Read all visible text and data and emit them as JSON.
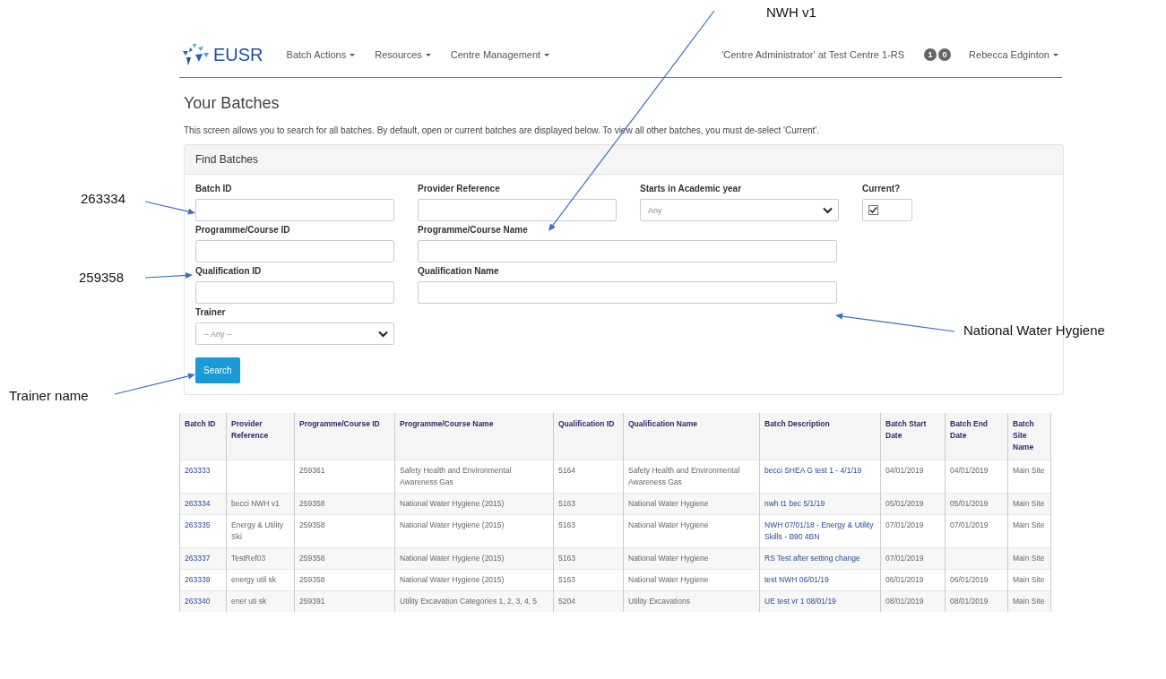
{
  "nav": {
    "brand": "EUSR",
    "menus": [
      {
        "label": "Batch Actions"
      },
      {
        "label": "Resources"
      },
      {
        "label": "Centre Management"
      }
    ],
    "role": "'Centre Administrator' at Test Centre 1-RS",
    "badges": [
      "1",
      "0"
    ],
    "user": "Rebecca Edginton"
  },
  "page": {
    "title": "Your Batches",
    "description": "This screen allows you to search for all batches. By default, open or current batches are displayed below. To view all other batches, you must de-select 'Current'."
  },
  "search_panel": {
    "title": "Find Batches",
    "rows": [
      [
        {
          "label": "Batch ID",
          "kind": "text"
        },
        {
          "label": "Provider Reference",
          "kind": "text"
        },
        {
          "label": "Starts in Academic year",
          "kind": "select",
          "value": "Any"
        },
        {
          "label": "Current?",
          "kind": "checkbox",
          "checked": true
        }
      ],
      [
        {
          "label": "Programme/Course ID",
          "kind": "text"
        },
        {
          "label": "Programme/Course Name",
          "kind": "wide-text"
        }
      ],
      [
        {
          "label": "Qualification ID",
          "kind": "text"
        },
        {
          "label": "Qualification Name",
          "kind": "wide-text"
        }
      ],
      [
        {
          "label": "Trainer",
          "kind": "select",
          "value": "-- Any --"
        }
      ]
    ],
    "button": "Search"
  },
  "table": {
    "columns": [
      {
        "label": "Batch ID",
        "kind": "link"
      },
      {
        "label": "Provider Reference",
        "kind": "text"
      },
      {
        "label": "Programme/Course ID",
        "kind": "text"
      },
      {
        "label": "Programme/Course Name",
        "kind": "text"
      },
      {
        "label": "Qualification ID",
        "kind": "text"
      },
      {
        "label": "Qualification Name",
        "kind": "text"
      },
      {
        "label": "Batch Description",
        "kind": "link"
      },
      {
        "label": "Batch Start Date",
        "kind": "text"
      },
      {
        "label": "Batch End Date",
        "kind": "text"
      },
      {
        "label": "Batch Site Name",
        "kind": "text"
      }
    ],
    "rows": [
      [
        "263333",
        "",
        "259361",
        "Safety Health and Environmental Awareness Gas",
        "5164",
        "Safety Health and Environmental Awareness Gas",
        "becci SHEA G test 1 - 4/1/19",
        "04/01/2019",
        "04/01/2019",
        "Main Site"
      ],
      [
        "263334",
        "becci NWH v1",
        "259358",
        "National Water Hygiene (2015)",
        "5163",
        "National Water Hygiene",
        "nwh t1 bec 5/1/19",
        "05/01/2019",
        "05/01/2019",
        "Main Site"
      ],
      [
        "263335",
        "Energy & Utility Ski",
        "259358",
        "National Water Hygiene (2015)",
        "5163",
        "National Water Hygiene",
        "NWH 07/01/18 - Energy & Utility Skills - B90 4BN",
        "07/01/2019",
        "07/01/2019",
        "Main Site"
      ],
      [
        "263337",
        "TestRef03",
        "259358",
        "National Water Hygiene (2015)",
        "5163",
        "National Water Hygiene",
        "RS Test after setting change",
        "07/01/2019",
        "",
        "Main Site"
      ],
      [
        "263339",
        "energy util sk",
        "259358",
        "National Water Hygiene (2015)",
        "5163",
        "National Water Hygiene",
        "test NWH 06/01/19",
        "06/01/2019",
        "06/01/2019",
        "Main Site"
      ],
      [
        "263340",
        "ener uti sk",
        "259391",
        "Utility Excavation Categories 1, 2, 3, 4, 5",
        "5204",
        "Utility Excavations",
        "UE test vr 1 08/01/19",
        "08/01/2019",
        "08/01/2019",
        "Main Site"
      ]
    ]
  },
  "annotations": [
    {
      "text": "NWH v1"
    },
    {
      "text": "263334"
    },
    {
      "text": "259358"
    },
    {
      "text": "National Water Hygiene"
    },
    {
      "text": "Trainer name"
    }
  ]
}
